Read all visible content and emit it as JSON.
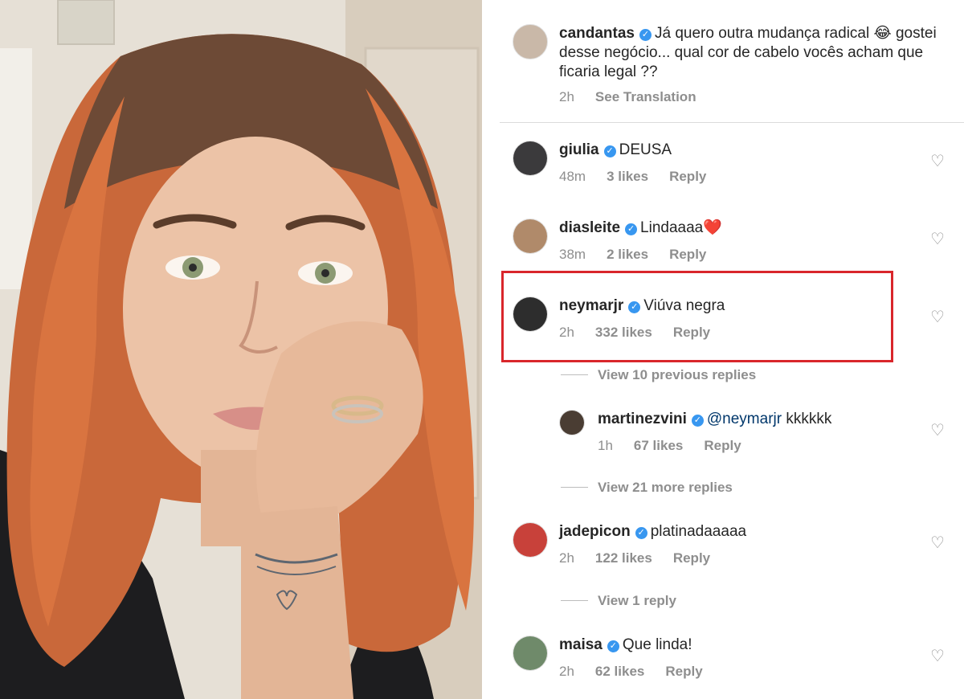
{
  "post": {
    "caption": {
      "username": "candantas",
      "text": "Já quero outra mudança radical 😂 gostei desse negócio... qual cor de cabelo vocês acham que ficaria legal ??",
      "time": "2h",
      "translate": "See Translation"
    }
  },
  "comments": [
    {
      "username": "giulia",
      "text": "DEUSA",
      "time": "48m",
      "likes": "3 likes",
      "reply": "Reply",
      "avatar_color": "#3b3a3c"
    },
    {
      "username": "diasleite",
      "text": "Lindaaaa❤️",
      "time": "38m",
      "likes": "2 likes",
      "reply": "Reply",
      "avatar_color": "#b08a6a"
    },
    {
      "username": "neymarjr",
      "text": "Viúva negra",
      "time": "2h",
      "likes": "332 likes",
      "reply": "Reply",
      "avatar_color": "#2d2d2d"
    },
    {
      "username": "jadepicon",
      "text": "platinadaaaaa",
      "time": "2h",
      "likes": "122 likes",
      "reply": "Reply",
      "avatar_color": "#c8413a"
    },
    {
      "username": "maisa",
      "text": "Que linda!",
      "time": "2h",
      "likes": "62 likes",
      "reply": "Reply",
      "avatar_color": "#6f8a6a"
    }
  ],
  "reply_thread": {
    "view_previous": "View 10 previous replies",
    "reply": {
      "username": "martinezvini",
      "mention": "@neymarjr",
      "text": "kkkkkk",
      "time": "1h",
      "likes": "67 likes",
      "reply": "Reply",
      "avatar_color": "#4a3d33"
    },
    "view_more": "View 21 more replies"
  },
  "view_one_reply": "View 1 reply",
  "colors": {
    "highlight": "#d9262b",
    "verified": "#3897f0",
    "muted": "#8e8e8e"
  }
}
